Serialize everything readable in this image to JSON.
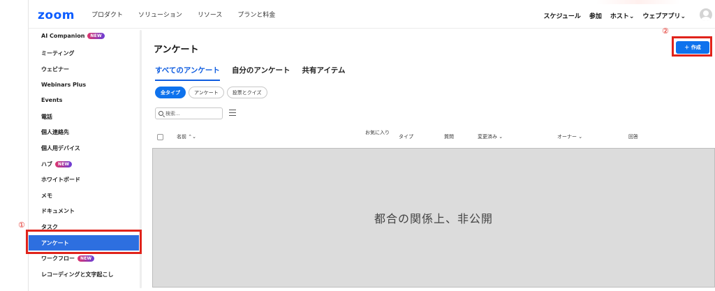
{
  "topnav": {
    "logo": "zoom",
    "left_links": [
      "プロダクト",
      "ソリューション",
      "リソース",
      "プランと料金"
    ],
    "right_links": [
      "スケジュール",
      "参加",
      "ホスト⌄",
      "ウェブアプリ⌄"
    ]
  },
  "sidebar": {
    "items": [
      {
        "label": "AI Companion",
        "badge": "NEW"
      },
      {
        "label": "ミーティング"
      },
      {
        "label": "ウェビナー"
      },
      {
        "label": "Webinars Plus"
      },
      {
        "label": "Events"
      },
      {
        "label": "電話"
      },
      {
        "label": "個人連絡先"
      },
      {
        "label": "個人用デバイス"
      },
      {
        "label": "ハブ",
        "badge": "NEW"
      },
      {
        "label": "ホワイトボード"
      },
      {
        "label": "メモ"
      },
      {
        "label": "ドキュメント"
      },
      {
        "label": "タスク"
      },
      {
        "label": "アンケート"
      },
      {
        "label": "ワークフロー",
        "badge": "NEW"
      },
      {
        "label": "レコーディングと文字起こし"
      }
    ],
    "active_label": "アンケート"
  },
  "annotations": {
    "one": "①",
    "two": "②"
  },
  "main": {
    "title": "アンケート",
    "create_button": "＋ 作成",
    "tabs": [
      "すべてのアンケート",
      "自分のアンケート",
      "共有アイテム"
    ],
    "filters": [
      "全タイプ",
      "アンケート",
      "投票とクイズ"
    ],
    "search_placeholder": "検索...",
    "columns": [
      "名前 ⌃⌄",
      "お気に入り",
      "タイプ",
      "質問",
      "変更済み ⌄",
      "オーナー ⌄",
      "回答"
    ],
    "redacted_text": "都合の関係上、非公開"
  },
  "colors": {
    "accent": "#0e72ed",
    "active_sidebar": "#2d6fe0",
    "annotation_red": "#e0231b"
  }
}
